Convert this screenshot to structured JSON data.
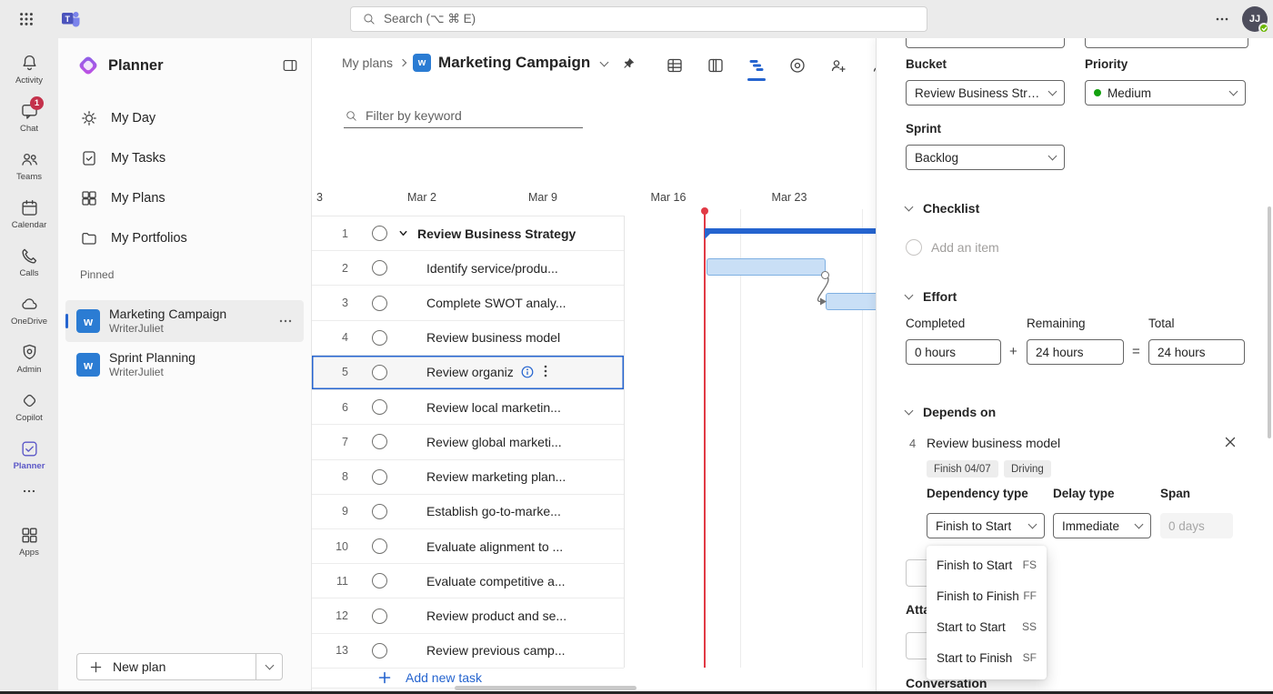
{
  "colors": {
    "accent_blue": "#2564cf",
    "today_red": "#e13a45",
    "planner_purple": "#5b57c7",
    "priority_green": "#13a10e",
    "plan_tile_blue": "#2b7cd3"
  },
  "top_bar": {
    "search_placeholder": "Search (⌥ ⌘ E)",
    "avatar_initials": "JJ"
  },
  "rail": {
    "items": [
      {
        "label": "Activity"
      },
      {
        "label": "Chat",
        "badge": "1"
      },
      {
        "label": "Teams"
      },
      {
        "label": "Calendar"
      },
      {
        "label": "Calls"
      },
      {
        "label": "OneDrive"
      },
      {
        "label": "Admin"
      },
      {
        "label": "Copilot"
      },
      {
        "label": "Planner",
        "active": true
      },
      {
        "label": "Apps"
      }
    ]
  },
  "sidebar": {
    "app_title": "Planner",
    "nav": [
      {
        "label": "My Day"
      },
      {
        "label": "My Tasks"
      },
      {
        "label": "My Plans"
      },
      {
        "label": "My Portfolios"
      }
    ],
    "pinned_header": "Pinned",
    "pinned": [
      {
        "icon_letter": "w",
        "title": "Marketing Campaign",
        "subtitle": "WriterJuliet",
        "selected": true
      },
      {
        "icon_letter": "w",
        "title": "Sprint Planning",
        "subtitle": "WriterJuliet",
        "selected": false
      }
    ],
    "new_plan_label": "New plan"
  },
  "header": {
    "breadcrumb_root": "My plans",
    "plan_icon_letter": "w",
    "plan_title": "Marketing Campaign"
  },
  "filter": {
    "placeholder": "Filter by keyword"
  },
  "timeline": {
    "date_labels": [
      "3",
      "Mar 2",
      "Mar 9",
      "Mar 16",
      "Mar 23"
    ],
    "tasks": [
      {
        "num": "1",
        "name": "Review Business Strategy",
        "summary": true
      },
      {
        "num": "2",
        "name": "Identify service/produ..."
      },
      {
        "num": "3",
        "name": "Complete SWOT analy..."
      },
      {
        "num": "4",
        "name": "Review business model"
      },
      {
        "num": "5",
        "name": "Review organiz",
        "selected": true
      },
      {
        "num": "6",
        "name": "Review local marketin..."
      },
      {
        "num": "7",
        "name": "Review global marketi..."
      },
      {
        "num": "8",
        "name": "Review marketing plan..."
      },
      {
        "num": "9",
        "name": "Establish go-to-marke..."
      },
      {
        "num": "10",
        "name": "Evaluate alignment to ..."
      },
      {
        "num": "11",
        "name": "Evaluate competitive a..."
      },
      {
        "num": "12",
        "name": "Review product and se..."
      },
      {
        "num": "13",
        "name": "Review previous camp..."
      }
    ],
    "add_task_label": "Add new task"
  },
  "details": {
    "bucket": {
      "label": "Bucket",
      "value": "Review Business Stra..."
    },
    "priority": {
      "label": "Priority",
      "value": "Medium"
    },
    "sprint": {
      "label": "Sprint",
      "value": "Backlog"
    },
    "checklist": {
      "label": "Checklist",
      "add_item_placeholder": "Add an item"
    },
    "effort": {
      "label": "Effort",
      "completed_label": "Completed",
      "completed_value": "0 hours",
      "plus_sign": "+",
      "remaining_label": "Remaining",
      "remaining_value": "24 hours",
      "equals_sign": "=",
      "total_label": "Total",
      "total_value": "24 hours"
    },
    "depends_on": {
      "label": "Depends on",
      "item_num": "4",
      "item_name": "Review business model",
      "tags": [
        "Finish 04/07",
        "Driving"
      ],
      "dependency_type_label": "Dependency type",
      "dependency_type_value": "Finish to Start",
      "delay_type_label": "Delay type",
      "delay_type_value": "Immediate",
      "span_label": "Span",
      "span_value": "0 days",
      "type_menu": [
        {
          "label": "Finish to Start",
          "code": "FS"
        },
        {
          "label": "Finish to Finish",
          "code": "FF"
        },
        {
          "label": "Start to Start",
          "code": "SS"
        },
        {
          "label": "Start to Finish",
          "code": "SF"
        }
      ]
    },
    "attachments_label": "Attachments",
    "conversation_label": "Conversation"
  }
}
